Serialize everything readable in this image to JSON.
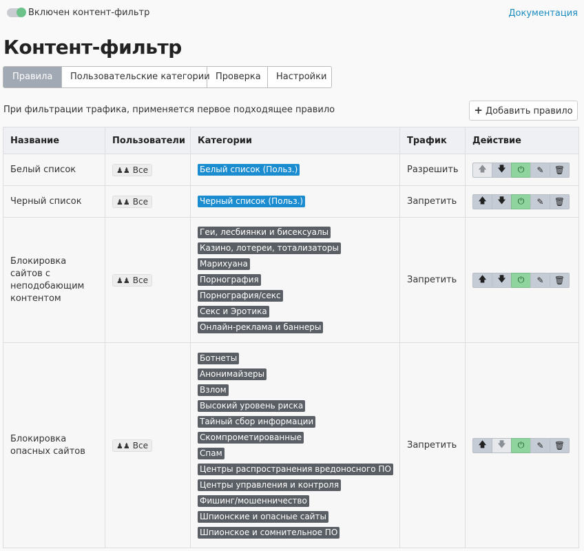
{
  "topbar": {
    "toggle_label": "Включен контент-фильтр",
    "doc_link": "Документация",
    "toggle_on": true
  },
  "page_title": "Контент-фильтр",
  "tabs": [
    {
      "label": "Правила",
      "active": true
    },
    {
      "label": "Пользовательские категории",
      "active": false
    },
    {
      "label": "Проверка",
      "active": false
    },
    {
      "label": "Настройки",
      "active": false
    }
  ],
  "hint": "При фильтрации трафика, применяется первое подходящее правило",
  "add_rule_label": "Добавить правило",
  "table": {
    "headers": [
      "Название",
      "Пользователи",
      "Категории",
      "Трафик",
      "Действие"
    ],
    "rows": [
      {
        "name": "Белый список",
        "users": "Все",
        "categories": [
          "Белый список (Польз.)"
        ],
        "custom_category": true,
        "traffic": "Разрешить",
        "up_enabled": false,
        "down_enabled": true
      },
      {
        "name": "Черный список",
        "users": "Все",
        "categories": [
          "Черный список (Польз.)"
        ],
        "custom_category": true,
        "traffic": "Запретить",
        "up_enabled": true,
        "down_enabled": true
      },
      {
        "name": "Блокировка сайтов с неподобающим контентом",
        "users": "Все",
        "categories": [
          "Геи, лесбиянки и бисексуалы",
          "Казино, лотереи, тотализаторы",
          "Марихуана",
          "Порнография",
          "Порнография/секс",
          "Секс и Эротика",
          "Онлайн-реклама и баннеры"
        ],
        "custom_category": false,
        "traffic": "Запретить",
        "up_enabled": true,
        "down_enabled": true
      },
      {
        "name": "Блокировка опасных сайтов",
        "users": "Все",
        "categories": [
          "Ботнеты",
          "Анонимайзеры",
          "Взлом",
          "Высокий уровень риска",
          "Тайный сбор информации",
          "Скомпрометированные",
          "Спам",
          "Центры распространения вредоносного ПО",
          "Центры управления и контроля",
          "Фишинг/мошенничество",
          "Шпионские и опасные сайты",
          "Шпионское и сомнительное ПО"
        ],
        "custom_category": false,
        "traffic": "Запретить",
        "up_enabled": true,
        "down_enabled": false
      }
    ]
  },
  "icons": {
    "users": "users-icon",
    "up": "arrow-up-icon",
    "down": "arrow-down-icon",
    "power": "power-icon",
    "edit": "pencil-icon",
    "delete": "trash-icon",
    "plus": "plus-icon"
  },
  "colors": {
    "toggle_on": "#6cc389",
    "link": "#1a8cc0",
    "active_tab": "#a1a9b4",
    "custom_category": "#1a8ccf",
    "category": "#5a5f65",
    "power_button": "#8fd39e"
  }
}
